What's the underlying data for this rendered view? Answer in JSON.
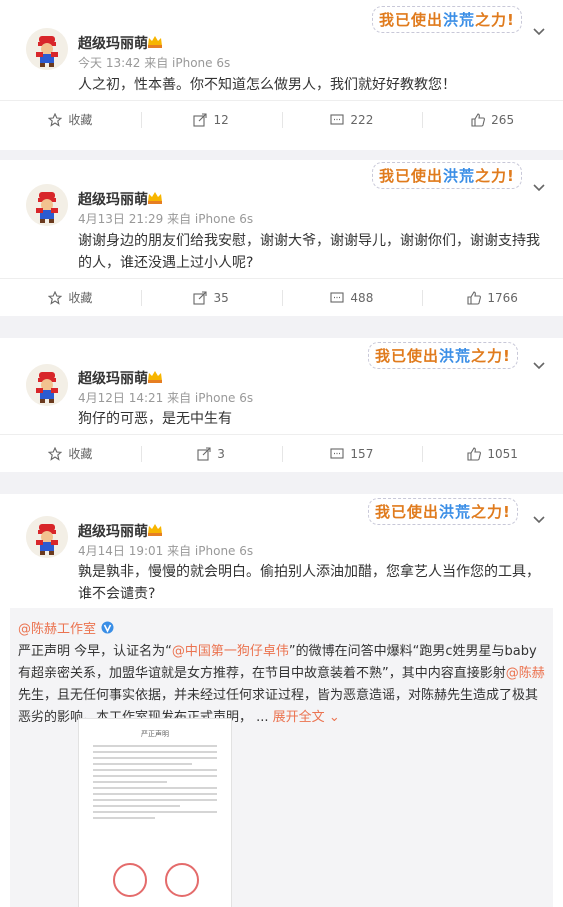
{
  "posts": [
    {
      "name": "超级玛丽萌",
      "time": "今天 13:42 来自 iPhone 6s",
      "text": "人之初，性本善。你不知道怎么做男人，我们就好好教教您！",
      "actions": {
        "fav": "收藏",
        "repost": "12",
        "comment": "222",
        "like": "265"
      }
    },
    {
      "name": "超级玛丽萌",
      "time": "4月13日 21:29 来自 iPhone 6s",
      "text": "谢谢身边的朋友们给我安慰，谢谢大爷，谢谢导儿，谢谢你们，谢谢支持我的人，谁还没遇上过小人呢?",
      "actions": {
        "fav": "收藏",
        "repost": "35",
        "comment": "488",
        "like": "1766"
      }
    },
    {
      "name": "超级玛丽萌",
      "time": "4月12日 14:21 来自 iPhone 6s",
      "text": "狗仔的可恶，是无中生有",
      "actions": {
        "fav": "收藏",
        "repost": "3",
        "comment": "157",
        "like": "1051"
      }
    },
    {
      "name": "超级玛丽萌",
      "time": "4月14日 19:01 来自 iPhone 6s",
      "text": "孰是孰非，慢慢的就会明白。偷拍别人添油加醋，您拿艺人当作您的工具，谁不会谴责?"
    }
  ],
  "sticker": {
    "a": "我已使出",
    "b": "洪荒",
    "c": "之力!"
  },
  "repost": {
    "author": "@陈赫工作室",
    "text_1": "严正声明 今早，认证名为“",
    "at_1": "@中国第一狗仔卓伟",
    "text_2": "”的微博在问答中爆料“跑男c姓男星与baby有超亲密关系，加盟华谊就是女方推荐，在节目中故意装着不熟”，其中内容直接影射",
    "at_2": "@陈赫",
    "text_3": " 先生，且无任何事实依据，并未经过任何求证过程，皆为恶意造谣，对陈赫先生造成了极其恶劣的影响。本工作室现发布正式声明， ...",
    "more": "展开全文",
    "doc_title": "严正声明"
  },
  "colors": {
    "accent": "#eb7350",
    "meta": "#999999"
  }
}
